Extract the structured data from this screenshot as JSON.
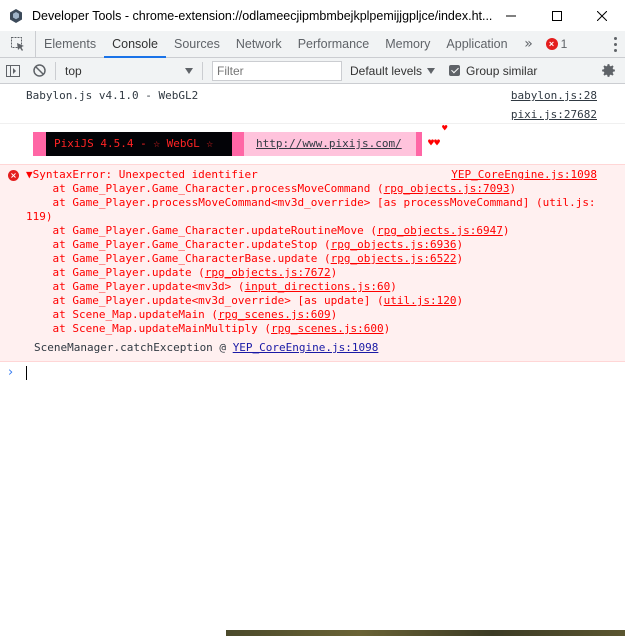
{
  "window": {
    "title": "Developer Tools - chrome-extension://odlameecjipmbmbejkplpemijjgpljce/index.ht..."
  },
  "tabs": [
    {
      "label": "Elements"
    },
    {
      "label": "Console"
    },
    {
      "label": "Sources"
    },
    {
      "label": "Network"
    },
    {
      "label": "Performance"
    },
    {
      "label": "Memory"
    },
    {
      "label": "Application"
    }
  ],
  "more_tabs": "»",
  "error_count": "1",
  "toolbar": {
    "context": "top",
    "filter_placeholder": "Filter",
    "levels_label": "Default levels",
    "group_similar_label": "Group similar"
  },
  "console": {
    "log1": {
      "text": "Babylon.js v4.1.0 - WebGL2",
      "source": "babylon.js:28"
    },
    "log2": {
      "source": "pixi.js:27682"
    },
    "pixi_banner": {
      "label": "PixiJS 4.5.4 - ☆ WebGL ☆",
      "url": "http://www.pixijs.com/",
      "hearts": "♥♥",
      "heart_top": "♥"
    },
    "error": {
      "header": "▼SyntaxError: Unexpected identifier",
      "source": "YEP_CoreEngine.js:1098",
      "stack": [
        {
          "fn": "    at Game_Player.Game_Character.processMoveCommand (",
          "file": "rpg_objects.js:7093",
          "tail": ")"
        },
        {
          "fn": "    at Game_Player.processMoveCommand<mv3d_override> [as processMoveCommand] (",
          "file": "util.js:119",
          "tail": ")"
        },
        {
          "fn": "    at Game_Player.Game_Character.updateRoutineMove (",
          "file": "rpg_objects.js:6947",
          "tail": ")"
        },
        {
          "fn": "    at Game_Player.Game_Character.updateStop (",
          "file": "rpg_objects.js:6936",
          "tail": ")"
        },
        {
          "fn": "    at Game_Player.Game_CharacterBase.update (",
          "file": "rpg_objects.js:6522",
          "tail": ")"
        },
        {
          "fn": "    at Game_Player.update (",
          "file": "rpg_objects.js:7672",
          "tail": ")"
        },
        {
          "fn": "    at Game_Player.update<mv3d> (",
          "file": "input_directions.js:60",
          "tail": ")"
        },
        {
          "fn": "    at Game_Player.update<mv3d_override> [as update] (",
          "file": "util.js:120",
          "tail": ")"
        },
        {
          "fn": "    at Scene_Map.updateMain (",
          "file": "rpg_scenes.js:609",
          "tail": ")"
        },
        {
          "fn": "    at Scene_Map.updateMainMultiply (",
          "file": "rpg_scenes.js:600",
          "tail": ")"
        }
      ],
      "caught_by": "SceneManager.catchException @ ",
      "caught_src": "YEP_CoreEngine.js:1098"
    }
  },
  "colors": {
    "error_text": "#ff0000",
    "error_bg": "#fff0f0",
    "accent": "#1a73e8",
    "pixi_pink": "#ff66a5"
  }
}
